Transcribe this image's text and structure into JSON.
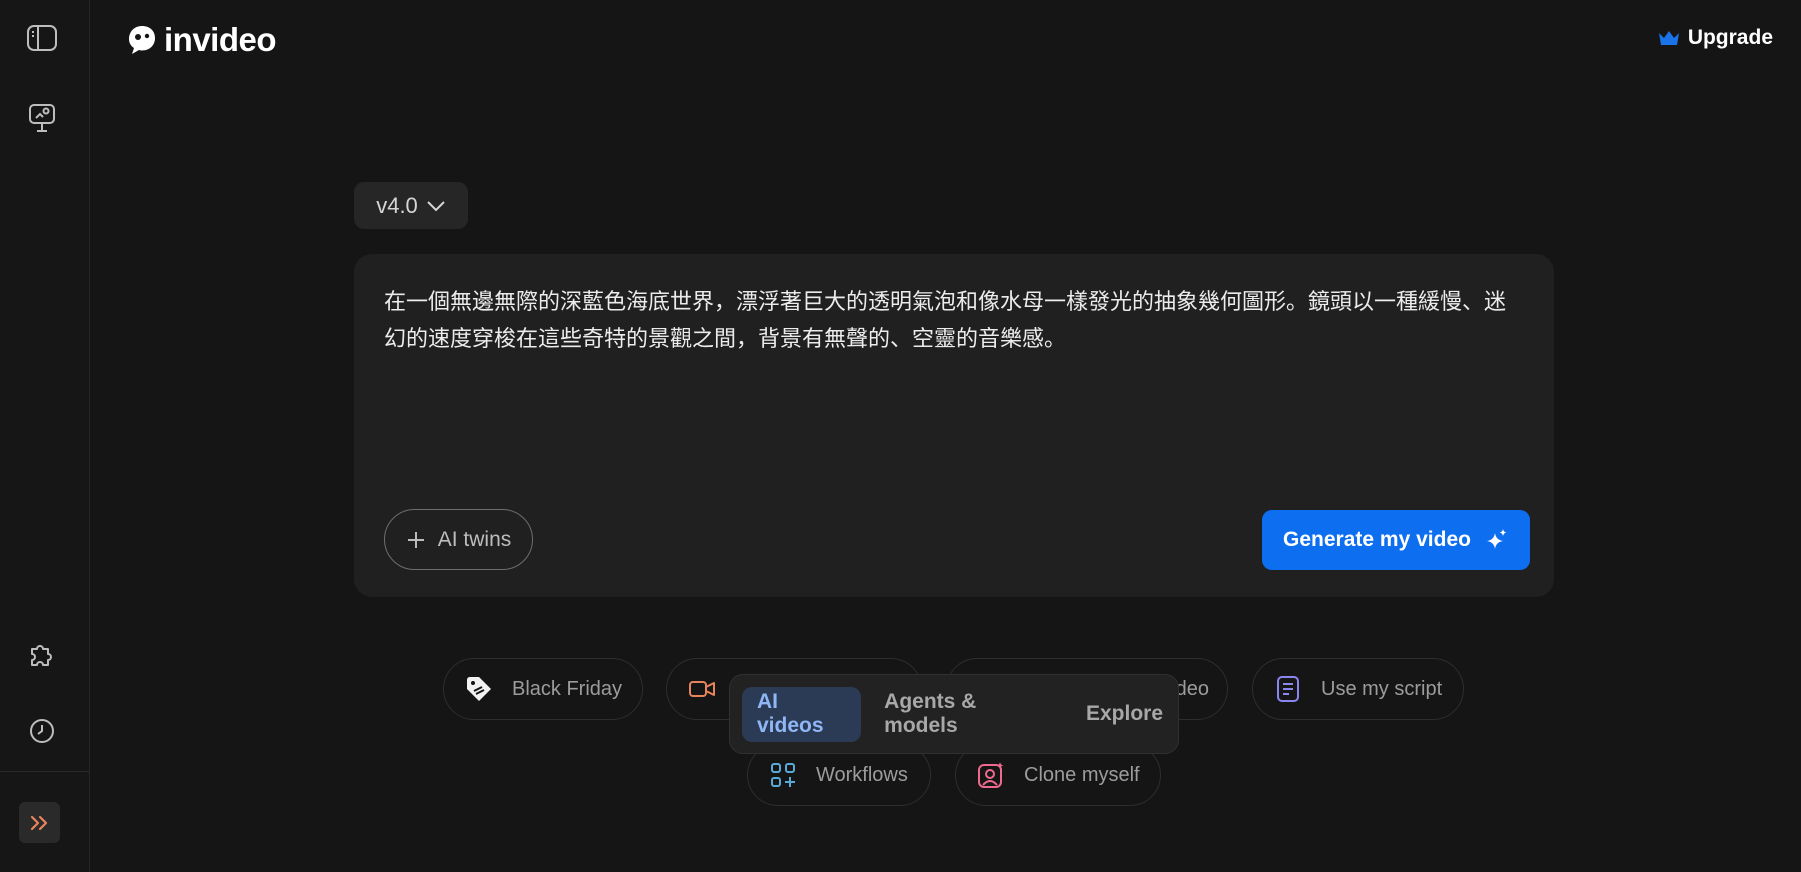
{
  "brand": {
    "name": "invideo"
  },
  "header": {
    "upgrade_label": "Upgrade"
  },
  "version_selector": {
    "selected": "v4.0"
  },
  "prompt": {
    "value": "在一個無邊無際的深藍色海底世界，漂浮著巨大的透明氣泡和像水母一樣發光的抽象幾何圖形。鏡頭以一種緩慢、迷幻的速度穿梭在這些奇特的景觀之間，背景有無聲的、空靈的音樂感。"
  },
  "actions": {
    "ai_twins_label": "AI twins",
    "generate_label": "Generate my video"
  },
  "chips": {
    "black_friday": "Black Friday",
    "partial_right": "deo",
    "use_script": "Use my script",
    "workflows": "Workflows",
    "clone_myself": "Clone myself"
  },
  "tabs": [
    {
      "label": "AI videos",
      "active": true
    },
    {
      "label": "Agents & models",
      "active": false
    },
    {
      "label": "Explore",
      "active": false
    }
  ],
  "colors": {
    "accent": "#0d6ef0",
    "crown": "#1a73e8",
    "tab_active_bg": "#2c3b55",
    "tab_active_text": "#8fb6f5"
  },
  "icons": {
    "sidebar_toggle": "sidebar-panel-icon",
    "presentation": "presentation-icon",
    "puzzle": "puzzle-icon",
    "history": "clock-icon",
    "expand": "double-chevron-right-icon",
    "crown": "crown-icon",
    "chevron": "chevron-down-icon",
    "plus": "plus-icon",
    "sparkle": "sparkle-icon",
    "tag": "tag-icon",
    "video": "video-camera-icon",
    "script": "document-icon",
    "workflows": "grid-plus-icon",
    "clone": "portrait-sparkle-icon"
  }
}
